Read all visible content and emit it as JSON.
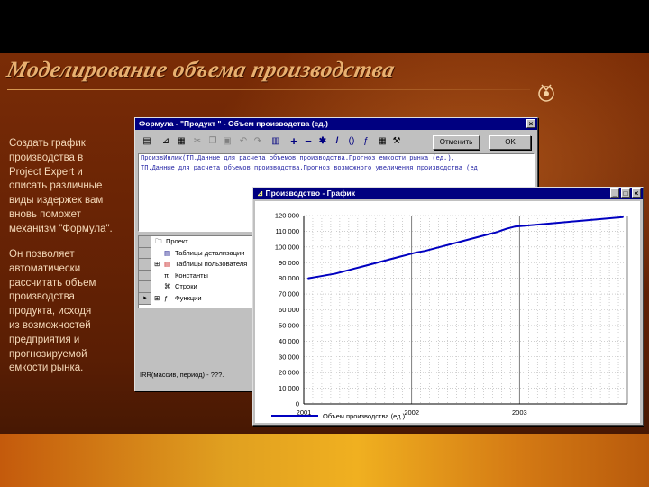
{
  "slide": {
    "title": "Моделирование объема производства",
    "text1_lines": [
      "Создать график",
      "производства в",
      "Project Expert и",
      "описать различные",
      "виды издержек вам",
      "вновь поможет",
      "механизм \"Формула\"."
    ],
    "text2_lines": [
      "Он позволяет",
      "автоматически",
      "рассчитать объем",
      "производства",
      "продукта, исходя",
      "из возможностей",
      "предприятия и",
      "прогнозируемой",
      "емкости рынка."
    ]
  },
  "formula_window": {
    "title": "Формула - \"Продукт \" - Объем производства (ед.)",
    "close_label": "×",
    "cancel_label": "Отменить",
    "ok_label": "OK",
    "code_lines": [
      "ПроизвИнлик(ТП.Данные для расчета объемов производства.Прогноз емкости рынка (ед.),",
      "ТП.Данные для расчета объемов производства.Прогноз возможного увеличения производства (ед"
    ],
    "tree_items": [
      "Проект",
      "Таблицы детализации",
      "Таблицы пользователя",
      "Константы",
      "Строки",
      "Функции"
    ],
    "status": "IRR(массив, период) - ???."
  },
  "chart_window": {
    "title": "Производство - График",
    "min_label": "_",
    "max_label": "□",
    "close_label": "×"
  },
  "chart_data": {
    "type": "line",
    "title": "",
    "xlabel": "",
    "ylabel": "",
    "x_ticks": [
      "2001",
      "2002",
      "2003"
    ],
    "ylim": [
      0,
      120000
    ],
    "y_ticks": [
      "0",
      "10 000",
      "20 000",
      "30 000",
      "40 000",
      "50 000",
      "60 000",
      "70 000",
      "80 000",
      "90 000",
      "100 000",
      "110 000",
      "120 000"
    ],
    "series": [
      {
        "name": "Объем производства (ед.)",
        "color": "#0000c0",
        "months": [
          0,
          1,
          2,
          3,
          4,
          5,
          6,
          7,
          8,
          9,
          10,
          11,
          12,
          13,
          14,
          15,
          16,
          17,
          18,
          19,
          20,
          21,
          22,
          23,
          24,
          25,
          26,
          27,
          28,
          29,
          30,
          31,
          32,
          33,
          34,
          35
        ],
        "values": [
          80000,
          81000,
          82000,
          83000,
          84500,
          86000,
          87500,
          89000,
          90500,
          92000,
          93500,
          95000,
          96500,
          97500,
          99000,
          100500,
          102000,
          103500,
          105000,
          106500,
          108000,
          109500,
          111500,
          113000,
          113500,
          114000,
          114500,
          115000,
          115500,
          116000,
          116500,
          117000,
          117500,
          118000,
          118500,
          119000
        ]
      }
    ],
    "grid": true,
    "legend": "bottom-left"
  },
  "colors": {
    "titlebar": "#000080",
    "series": "#0000c0"
  }
}
